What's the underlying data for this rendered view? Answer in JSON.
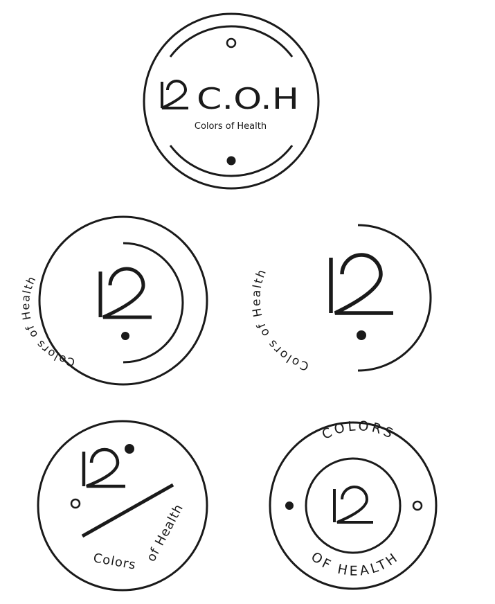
{
  "ink_color": "#1a1a1a",
  "badge1": {
    "wordmark": "C.O.H",
    "tagline": "Colors of Health"
  },
  "badge2": {
    "tagline": "Colors of Health"
  },
  "badge3": {
    "tagline": "Colors of Health"
  },
  "badge4": {
    "tagline_left": "Colors",
    "tagline_right": "of Health"
  },
  "badge5": {
    "top_text": "COLORS",
    "bottom_text": "OF HEALTH"
  }
}
